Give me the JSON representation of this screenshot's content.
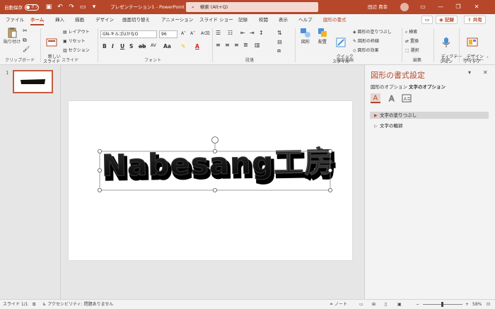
{
  "titlebar": {
    "autosave_label": "自動保存",
    "autosave_state": "オフ",
    "doc_title": "プレゼンテーション1 - PowerPoint",
    "search_placeholder": "検索 (Alt+Q)",
    "user_name": "田辺 貴幸"
  },
  "tabs": {
    "items": [
      "ファイル",
      "ホーム",
      "挿入",
      "描画",
      "デザイン",
      "画面切り替え",
      "アニメーション",
      "スライド ショー",
      "記録",
      "校閲",
      "表示",
      "ヘルプ",
      "図形の書式"
    ],
    "active": "ホーム",
    "record_button": "記録",
    "share_button": "共有"
  },
  "ribbon": {
    "clipboard": {
      "paste": "貼り付け",
      "group_label": "クリップボード"
    },
    "slides": {
      "new_slide": "新しい\nスライド",
      "layout": "レイアウト",
      "reset": "リセット",
      "section": "セクション",
      "group_label": "スライド"
    },
    "font": {
      "font_name": "GN-キルゴUかなO",
      "font_size": "96",
      "group_label": "フォント"
    },
    "paragraph": {
      "group_label": "段落"
    },
    "drawing": {
      "shape": "図形",
      "arrange": "配置",
      "quick_style": "クイック\nスタイル",
      "fill": "図形の塗りつぶし",
      "outline": "図形の枠線",
      "effects": "図形の効果",
      "group_label": "図形描画"
    },
    "editing": {
      "find": "検索",
      "replace": "置換",
      "select": "選択",
      "group_label": "編集"
    },
    "voice": {
      "dictate": "ディクテー\nション",
      "group_label": "音声"
    },
    "designer": {
      "ideas": "デザイン\nアイデア",
      "group_label": "デザイナー"
    }
  },
  "thumbnail": {
    "number": "1"
  },
  "slide": {
    "wordart_text": "Nabesang工房"
  },
  "format_pane": {
    "title": "図形の書式設定",
    "tab_shape": "図形のオプション",
    "tab_text": "文字のオプション",
    "section_fill": "文字の塗りつぶし",
    "section_outline": "文字の輪郭"
  },
  "status": {
    "slide_info": "スライド 1/1",
    "accessibility": "アクセシビリティ: 問題ありません",
    "notes": "ノート",
    "zoom": "58%"
  },
  "colors": {
    "accent": "#b7472a",
    "ribbon_bg": "#f3f3f3",
    "canvas_bg": "#e6e6e6"
  }
}
